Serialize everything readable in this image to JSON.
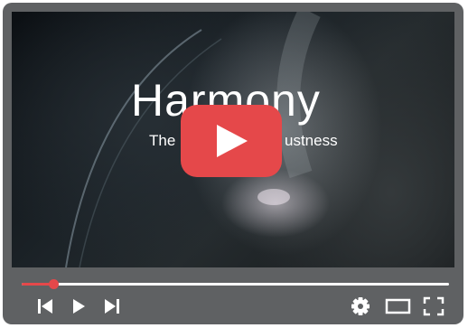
{
  "video": {
    "title": "Harmony",
    "subtitle_left": "The",
    "subtitle_right": "ustness"
  },
  "player": {
    "progress_fraction": 0.075,
    "accent_color": "#e5484a",
    "frame_color": "#5f6163",
    "icons": {
      "big_play": "play-icon",
      "previous": "skip-previous-icon",
      "play": "play-icon",
      "next": "skip-next-icon",
      "settings": "gear-icon",
      "theater": "theater-mode-icon",
      "fullscreen": "fullscreen-icon"
    }
  }
}
